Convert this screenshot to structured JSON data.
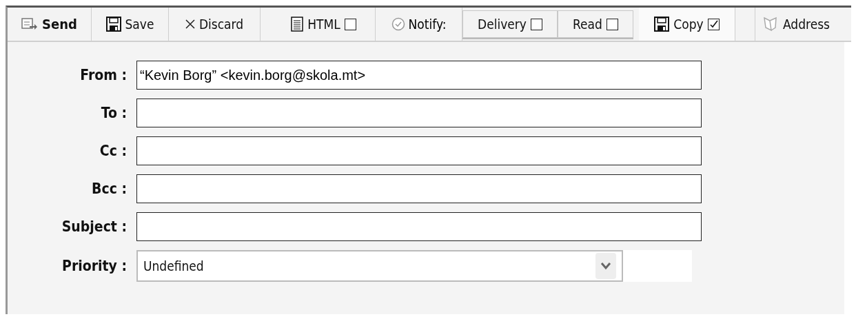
{
  "toolbar": {
    "items": [
      {
        "kind": "send",
        "label": "Send"
      },
      {
        "kind": "save",
        "label": "Save"
      },
      {
        "kind": "discard",
        "label": "Discard"
      },
      {
        "kind": "html",
        "label": "HTML",
        "checked": false
      },
      {
        "kind": "notify",
        "label": "Notify:"
      },
      {
        "kind": "check-button",
        "label": "Delivery",
        "checked": false
      },
      {
        "kind": "check-button",
        "label": "Read",
        "checked": false
      },
      {
        "kind": "copy",
        "label": "Copy",
        "checked": true
      },
      {
        "kind": "address",
        "label": "Address"
      }
    ]
  },
  "form": {
    "fields": [
      {
        "label": "From :",
        "value": "“Kevin Borg” <kevin.borg@skola.mt>"
      },
      {
        "label": "To :"
      },
      {
        "label": "Cc :"
      },
      {
        "label": "Bcc :"
      },
      {
        "label": "Subject :"
      }
    ],
    "priority": {
      "label": "Priority :",
      "value": "Undefined"
    }
  }
}
